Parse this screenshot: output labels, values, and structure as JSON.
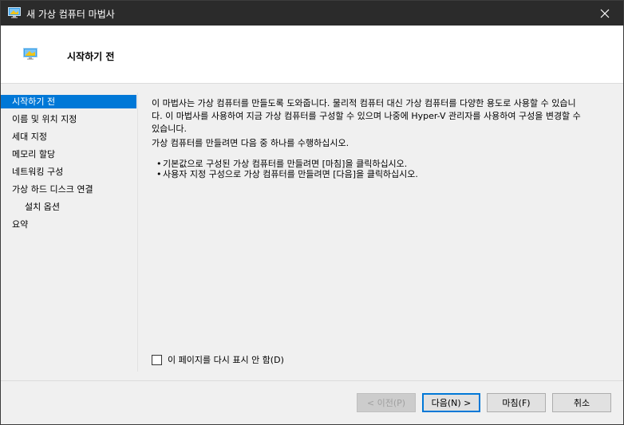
{
  "window": {
    "title": "새 가상 컴퓨터 마법사",
    "header_title": "시작하기 전"
  },
  "nav": {
    "items": [
      {
        "label": "시작하기 전",
        "active": true
      },
      {
        "label": "이름 및 위치 지정"
      },
      {
        "label": "세대 지정"
      },
      {
        "label": "메모리 할당"
      },
      {
        "label": "네트워킹 구성"
      },
      {
        "label": "가상 하드 디스크 연결"
      },
      {
        "label": "설치 옵션",
        "sub": true
      },
      {
        "label": "요약"
      }
    ]
  },
  "content": {
    "intro_line1": "이 마법사는 가상 컴퓨터를 만들도록 도와줍니다. 물리적 컴퓨터 대신 가상 컴퓨터를 다양한 용도로 사용할 수 있습니",
    "intro_line2": "다. 이 마법사를 사용하여 지금 가상 컴퓨터를 구성할 수 있으며 나중에 Hyper-V 관리자를 사용하여 구성을 변경할 수",
    "intro_line3": "있습니다.",
    "instruction": "가상 컴퓨터를 만들려면 다음 중 하나를 수행하십시오.",
    "bullets": [
      "기본값으로 구성된 가상 컴퓨터를 만들려면 [마침]을 클릭하십시오.",
      "사용자 지정 구성으로 가상 컴퓨터를 만들려면 [다음]을 클릭하십시오."
    ],
    "checkbox_label": "이 페이지를 다시 표시 안 함(D)",
    "checkbox_checked": false
  },
  "buttons": {
    "prev": "< 이전(P)",
    "next": "다음(N) >",
    "finish": "마침(F)",
    "cancel": "취소"
  },
  "icons": {
    "app": "hyper-v-vm-icon",
    "close": "close-icon"
  },
  "colors": {
    "titlebar_bg": "#2b2b2b",
    "accent": "#0078d7"
  }
}
